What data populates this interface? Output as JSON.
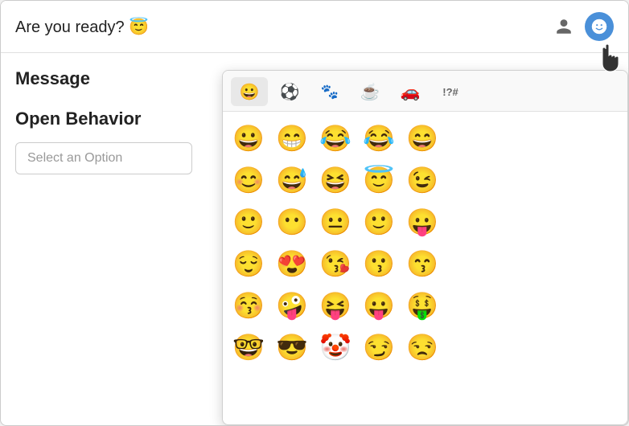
{
  "header": {
    "title": "Are you ready? 😇",
    "profile_icon_label": "Profile",
    "emoji_icon_label": "Emoji"
  },
  "left_panel": {
    "message_label": "Message",
    "open_behavior_label": "Open Behavior",
    "select_placeholder": "Select an Option"
  },
  "emoji_picker": {
    "tabs": [
      {
        "id": "smiley",
        "icon": "😀",
        "label": "Smiley",
        "active": true
      },
      {
        "id": "ball",
        "icon": "⚽",
        "label": "Ball"
      },
      {
        "id": "paw",
        "icon": "🐾",
        "label": "Paw"
      },
      {
        "id": "cup",
        "icon": "☕",
        "label": "Cup"
      },
      {
        "id": "car",
        "icon": "🚗",
        "label": "Car"
      },
      {
        "id": "symbols",
        "symbol": "!?#",
        "label": "Symbols"
      }
    ],
    "emojis": [
      [
        "😀",
        "😁",
        "😂",
        "😂",
        "😄"
      ],
      [
        "😊",
        "😅",
        "😆",
        "😇",
        "😉"
      ],
      [
        "🙂",
        "😶",
        "😐",
        "🙂",
        "😛"
      ],
      [
        "😌",
        "😍",
        "😘",
        "😗",
        "😙"
      ],
      [
        "😚",
        "🤪",
        "😝",
        "😛",
        "🤑"
      ],
      [
        "🤓",
        "😎",
        "🤡",
        "😏",
        "😒"
      ]
    ]
  }
}
